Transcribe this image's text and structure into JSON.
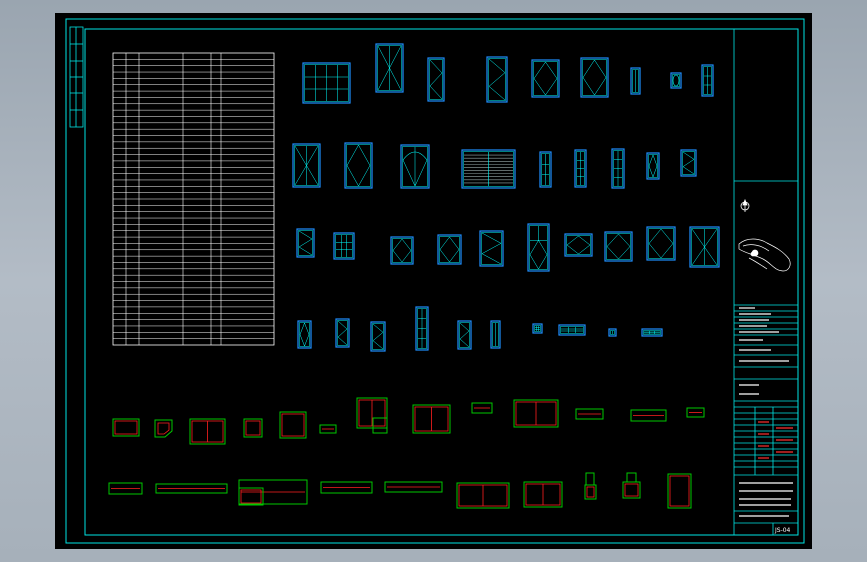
{
  "drawing": {
    "title_block": {
      "drawing_no": "JS-04"
    },
    "colors": {
      "frame": "#00e5e5",
      "window_outline": "#1e8fff",
      "window_detail": "#00ffff",
      "plan_outline": "#00c800",
      "plan_detail": "#ff2020",
      "schedule_lines": "#ffffff",
      "background": "#000000"
    }
  }
}
